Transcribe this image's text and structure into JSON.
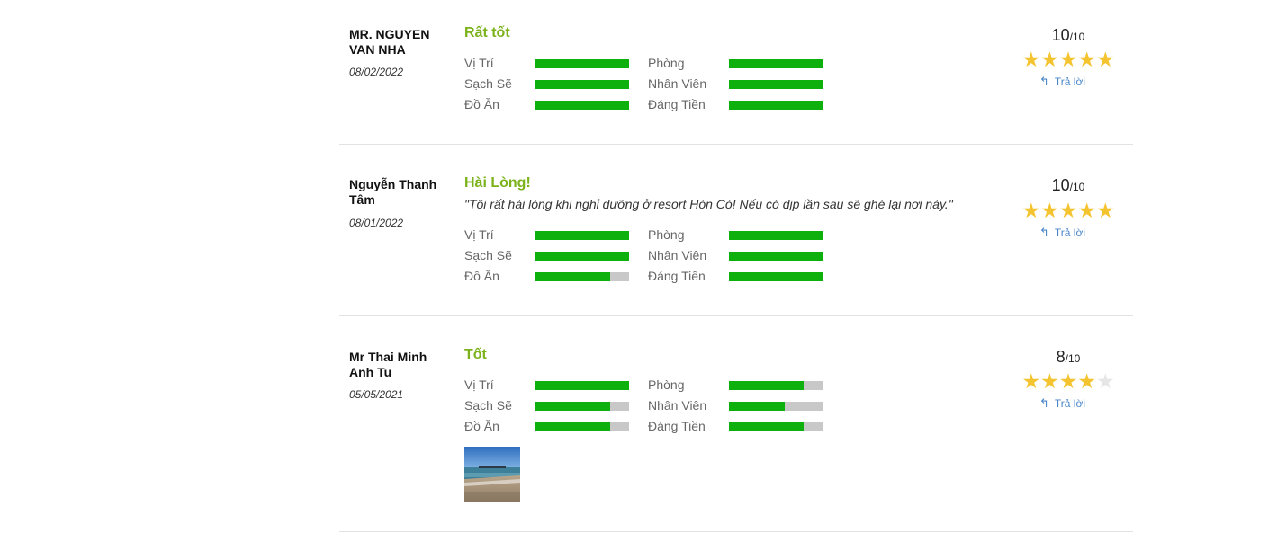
{
  "reply_label": "Trả lời",
  "colors": {
    "title": "#7cb31c",
    "bar_fill": "#0db00d",
    "bar_track": "#c8c8c8",
    "star_on": "#f4c430",
    "star_off": "#e6e6e6",
    "reply_link": "#4a86c8"
  },
  "reviews": [
    {
      "name": "MR. NGUYEN VAN NHA",
      "date": "08/02/2022",
      "title": "Rất tốt",
      "comment": "",
      "score": "10",
      "score_max": "/10",
      "stars": 5,
      "criteria": [
        {
          "label": "Vị Trí",
          "value": 1.0
        },
        {
          "label": "Phòng",
          "value": 1.0
        },
        {
          "label": "Sạch Sẽ",
          "value": 1.0
        },
        {
          "label": "Nhân Viên",
          "value": 1.0
        },
        {
          "label": "Đồ Ăn",
          "value": 1.0
        },
        {
          "label": "Đáng Tiền",
          "value": 1.0
        }
      ]
    },
    {
      "name": "Nguyễn Thanh Tâm",
      "date": "08/01/2022",
      "title": "Hài Lòng!",
      "comment": "\"Tôi rất hài lòng khi nghỉ dưỡng ở resort Hòn Cò! Nếu có dịp lần sau sẽ ghé lại nơi này.\"",
      "score": "10",
      "score_max": "/10",
      "stars": 5,
      "criteria": [
        {
          "label": "Vị Trí",
          "value": 1.0
        },
        {
          "label": "Phòng",
          "value": 1.0
        },
        {
          "label": "Sạch Sẽ",
          "value": 1.0
        },
        {
          "label": "Nhân Viên",
          "value": 1.0
        },
        {
          "label": "Đồ Ăn",
          "value": 0.8
        },
        {
          "label": "Đáng Tiền",
          "value": 1.0
        }
      ]
    },
    {
      "name": "Mr Thai Minh Anh Tu",
      "date": "05/05/2021",
      "title": "Tốt",
      "comment": "",
      "score": "8",
      "score_max": "/10",
      "stars": 4,
      "criteria": [
        {
          "label": "Vị Trí",
          "value": 1.0
        },
        {
          "label": "Phòng",
          "value": 0.8
        },
        {
          "label": "Sạch Sẽ",
          "value": 0.8
        },
        {
          "label": "Nhân Viên",
          "value": 0.6
        },
        {
          "label": "Đồ Ăn",
          "value": 0.8
        },
        {
          "label": "Đáng Tiền",
          "value": 0.8
        }
      ]
    }
  ]
}
